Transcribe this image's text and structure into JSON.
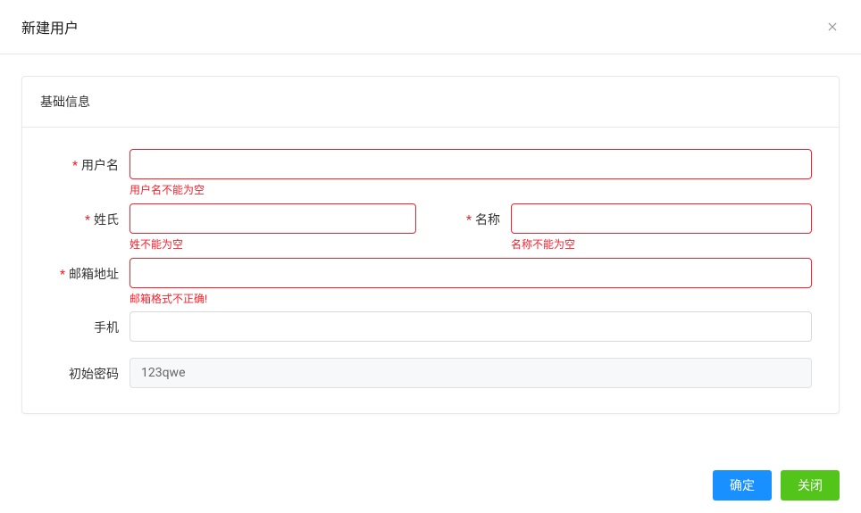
{
  "modal": {
    "title": "新建用户",
    "section_title": "基础信息"
  },
  "fields": {
    "username": {
      "label": "用户名",
      "value": "",
      "error": "用户名不能为空"
    },
    "lastname": {
      "label": "姓氏",
      "value": "",
      "error": "姓不能为空"
    },
    "firstname": {
      "label": "名称",
      "value": "",
      "error": "名称不能为空"
    },
    "email": {
      "label": "邮箱地址",
      "value": "",
      "error": "邮箱格式不正确!"
    },
    "phone": {
      "label": "手机",
      "value": ""
    },
    "initial_password": {
      "label": "初始密码",
      "value": "123qwe"
    }
  },
  "buttons": {
    "confirm": "确定",
    "close": "关闭"
  }
}
